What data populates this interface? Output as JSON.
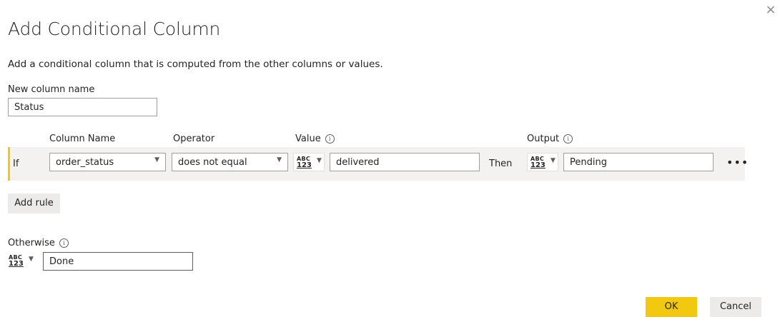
{
  "dialog": {
    "title": "Add Conditional Column",
    "close_symbol": "×",
    "description": "Add a conditional column that is computed from the other columns or values."
  },
  "new_column": {
    "label": "New column name",
    "value": "Status"
  },
  "headers": {
    "column_name": "Column Name",
    "operator": "Operator",
    "value": "Value",
    "output": "Output",
    "info_symbol": "i"
  },
  "rule": {
    "if_label": "If",
    "column": "order_status",
    "operator": "does not equal",
    "type_top": "ABC",
    "type_bottom": "123",
    "value": "delivered",
    "then_label": "Then",
    "output": "Pending",
    "more_symbol": "•••"
  },
  "add_rule_label": "Add rule",
  "otherwise": {
    "label": "Otherwise",
    "value": "Done"
  },
  "footer": {
    "ok_label": "OK",
    "cancel_label": "Cancel"
  },
  "colors": {
    "accent": "#f2c811",
    "row_background": "#f3f2f1"
  },
  "icons": {
    "close": "close-icon",
    "info": "info-icon",
    "dropdown": "chevron-down-icon",
    "type": "any-type-icon",
    "more": "ellipsis-icon"
  }
}
